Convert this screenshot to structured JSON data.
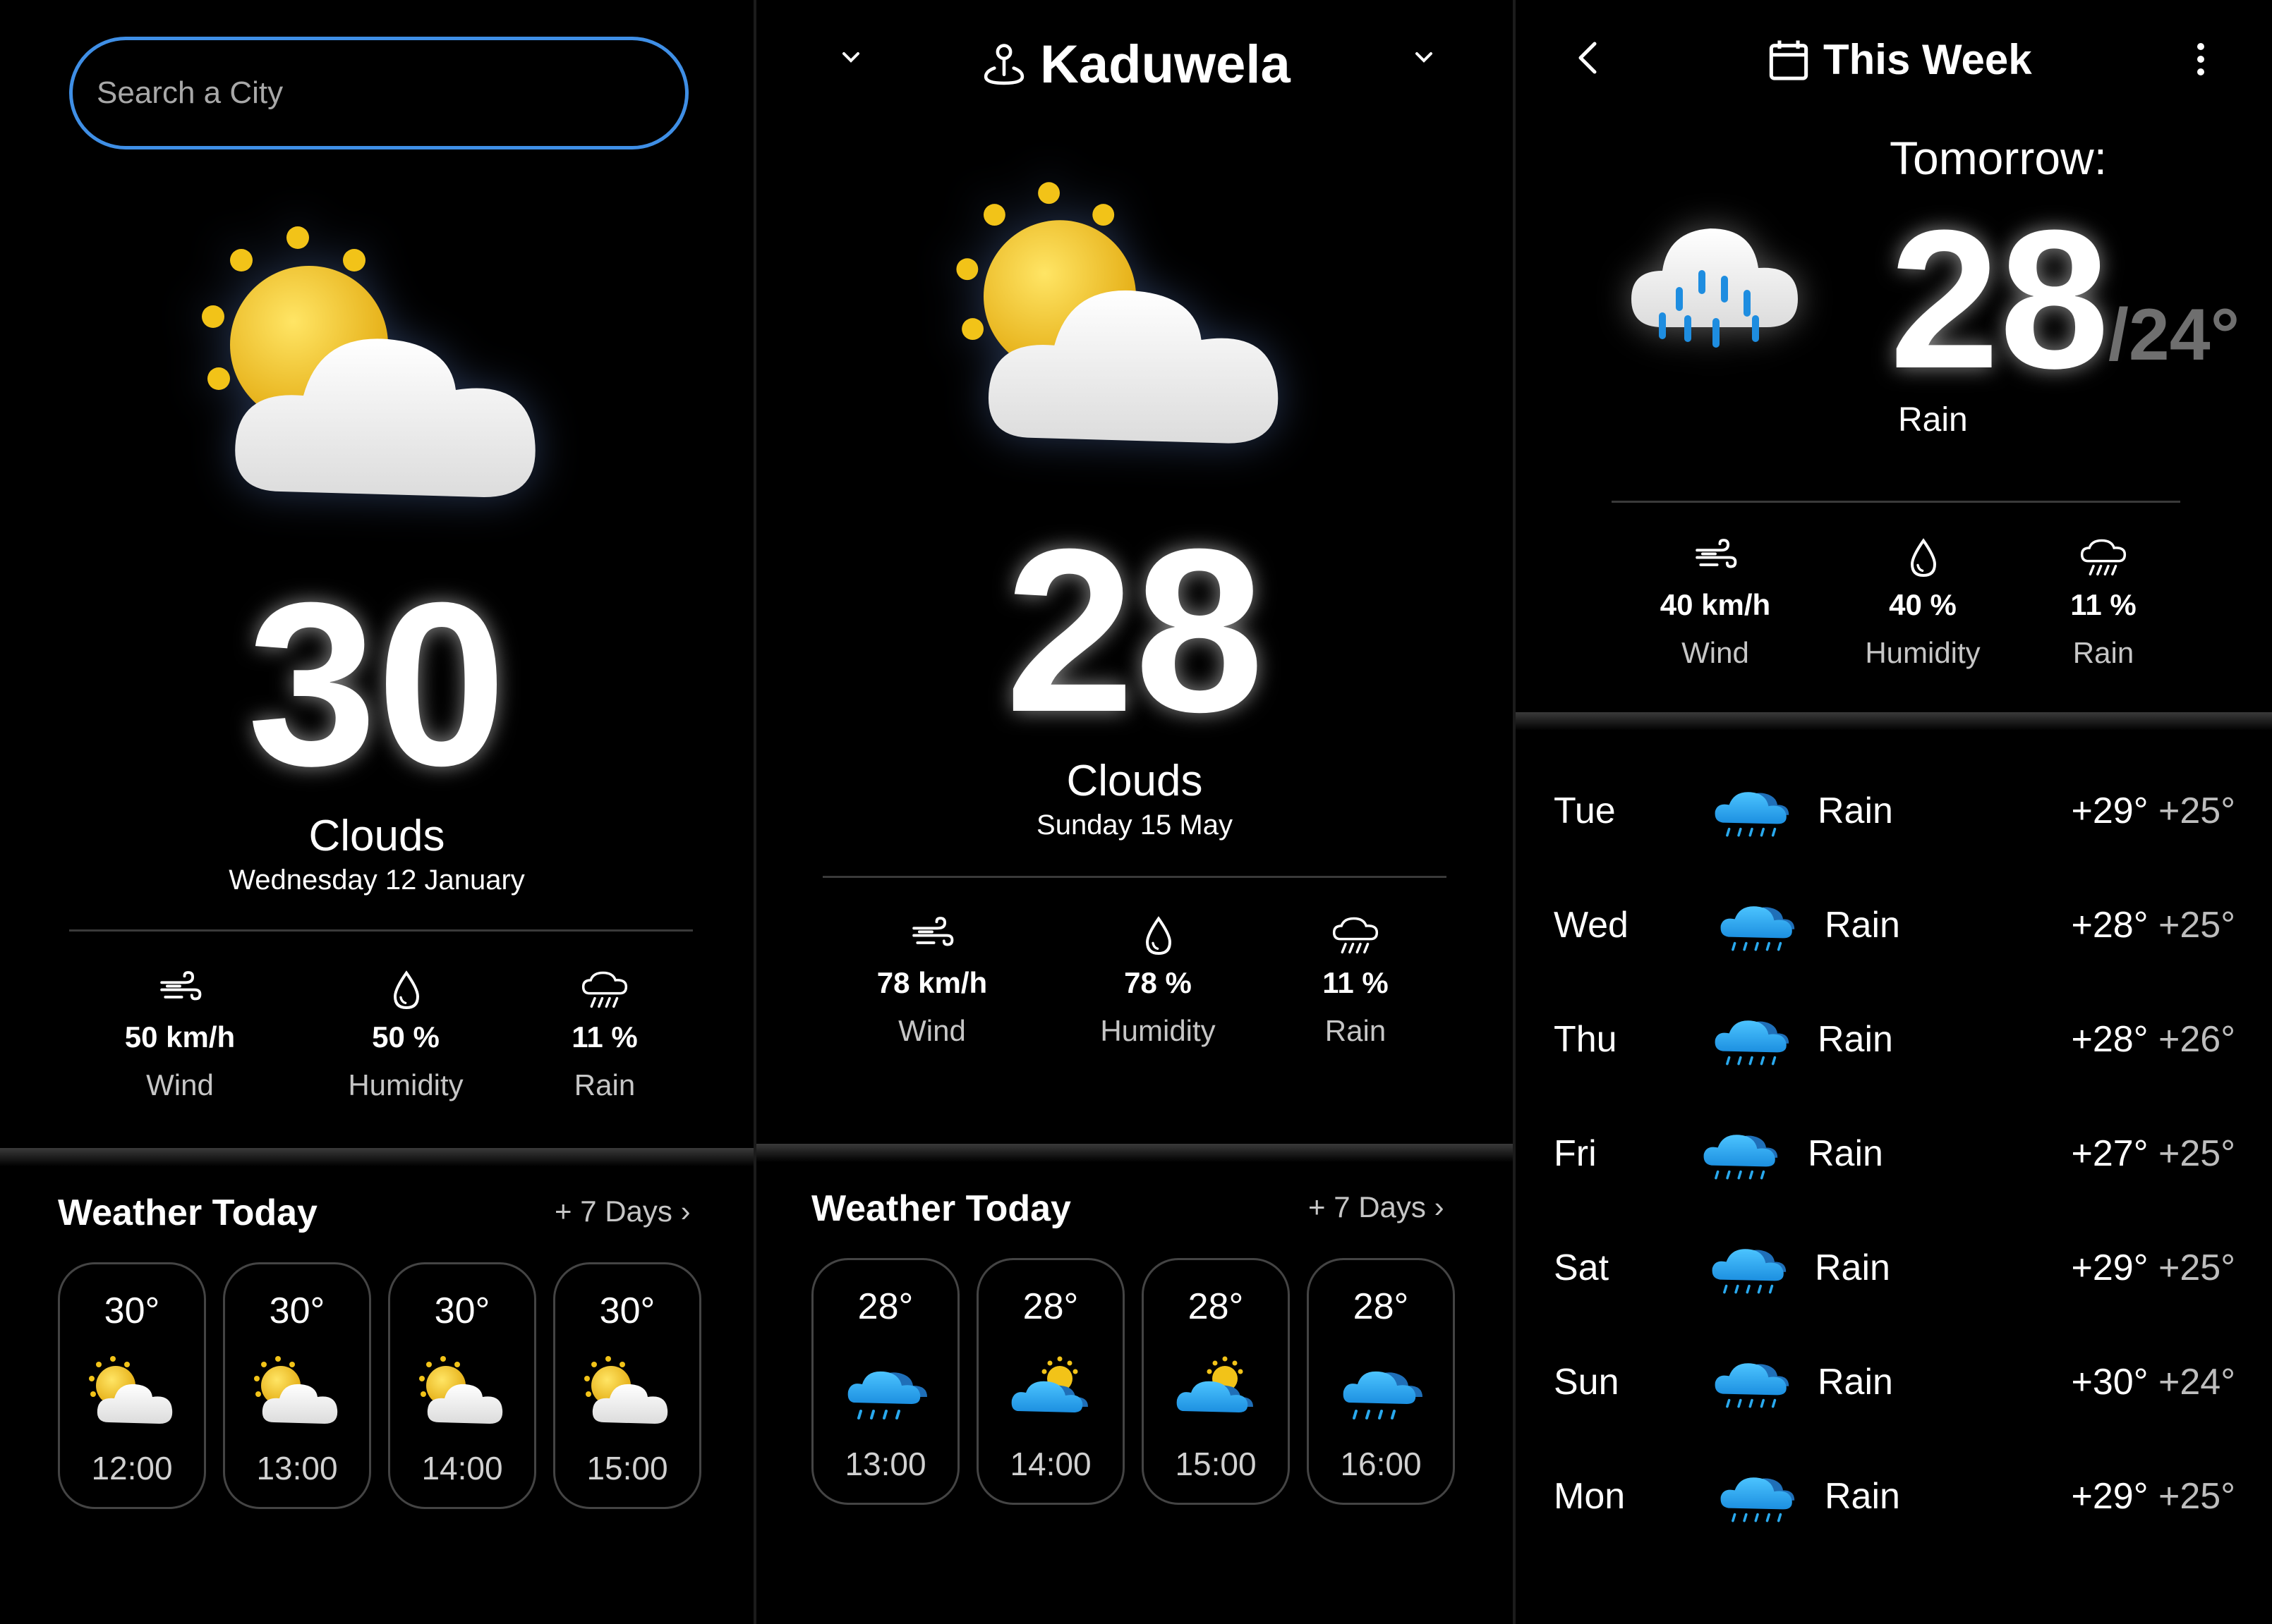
{
  "panel1": {
    "search_placeholder": "Search a City",
    "temperature": "30",
    "condition": "Clouds",
    "date": "Wednesday 12 January",
    "stats": [
      {
        "value": "50 km/h",
        "label": "Wind",
        "icon": "wind-icon"
      },
      {
        "value": "50 %",
        "label": "Humidity",
        "icon": "droplet-icon"
      },
      {
        "value": "11 %",
        "label": "Rain",
        "icon": "rain-cloud-icon"
      }
    ],
    "section_title": "Weather Today",
    "more_link": "+ 7 Days",
    "hourly": [
      {
        "temp": "30°",
        "time": "12:00",
        "icon": "partly-cloudy-icon"
      },
      {
        "temp": "30°",
        "time": "13:00",
        "icon": "partly-cloudy-icon"
      },
      {
        "temp": "30°",
        "time": "14:00",
        "icon": "partly-cloudy-icon"
      },
      {
        "temp": "30°",
        "time": "15:00",
        "icon": "partly-cloudy-icon"
      }
    ]
  },
  "panel2": {
    "location": "Kaduwela",
    "temperature": "28",
    "condition": "Clouds",
    "date": "Sunday 15 May",
    "stats": [
      {
        "value": "78 km/h",
        "label": "Wind",
        "icon": "wind-icon"
      },
      {
        "value": "78 %",
        "label": "Humidity",
        "icon": "droplet-icon"
      },
      {
        "value": "11 %",
        "label": "Rain",
        "icon": "rain-cloud-icon"
      }
    ],
    "section_title": "Weather Today",
    "more_link": "+ 7 Days",
    "hourly": [
      {
        "temp": "28°",
        "time": "13:00",
        "icon": "rain-icon"
      },
      {
        "temp": "28°",
        "time": "14:00",
        "icon": "sun-cloud-icon"
      },
      {
        "temp": "28°",
        "time": "15:00",
        "icon": "sun-cloud-icon"
      },
      {
        "temp": "28°",
        "time": "16:00",
        "icon": "rain-icon"
      }
    ]
  },
  "panel3": {
    "title": "This Week",
    "tomorrow_label": "Tomorrow:",
    "temperature": "28",
    "low_temp": "/24°",
    "condition": "Rain",
    "stats": [
      {
        "value": "40 km/h",
        "label": "Wind",
        "icon": "wind-icon"
      },
      {
        "value": "40 %",
        "label": "Humidity",
        "icon": "droplet-icon"
      },
      {
        "value": "11 %",
        "label": "Rain",
        "icon": "rain-cloud-icon"
      }
    ],
    "days": [
      {
        "day": "Tue",
        "condition": "Rain",
        "high": "+29°",
        "low": "+25°"
      },
      {
        "day": "Wed",
        "condition": "Rain",
        "high": "+28°",
        "low": "+25°"
      },
      {
        "day": "Thu",
        "condition": "Rain",
        "high": "+28°",
        "low": "+26°"
      },
      {
        "day": "Fri",
        "condition": "Rain",
        "high": "+27°",
        "low": "+25°"
      },
      {
        "day": "Sat",
        "condition": "Rain",
        "high": "+29°",
        "low": "+25°"
      },
      {
        "day": "Sun",
        "condition": "Rain",
        "high": "+30°",
        "low": "+24°"
      },
      {
        "day": "Mon",
        "condition": "Rain",
        "high": "+29°",
        "low": "+25°"
      }
    ]
  },
  "colors": {
    "accent": "#3f8fe6",
    "rain_blue": "#29a9ee",
    "sun_yellow": "#f2c318"
  }
}
